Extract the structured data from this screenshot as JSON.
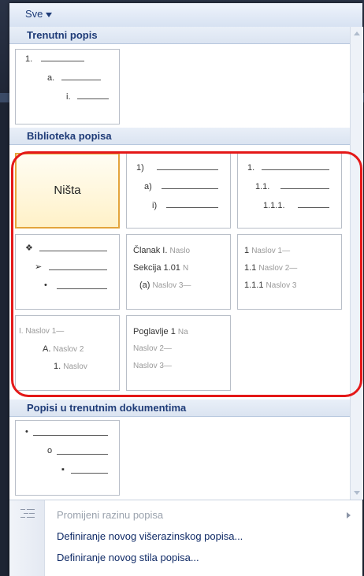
{
  "filter": {
    "label": "Sve"
  },
  "sections": {
    "current": "Trenutni popis",
    "library": "Biblioteka popisa",
    "documents": "Popisi u trenutnim dokumentima"
  },
  "current_tile": {
    "l1": "1.",
    "l2": "a.",
    "l3": "i."
  },
  "library_tiles": {
    "none": {
      "label": "Ništa"
    },
    "numbered": {
      "l1": "1)",
      "l2": "a)",
      "l3": "i)"
    },
    "decimal": {
      "l1": "1.",
      "l2": "1.1.",
      "l3": "1.1.1."
    },
    "bullets": {
      "l1": "❖",
      "l2": "➢",
      "l3": "•"
    },
    "article": {
      "l1": "Članak I.",
      "l1b": "Naslo",
      "l2": "Sekcija 1.01",
      "l2b": "N",
      "l3": "(a)",
      "l3b": "Naslov 3—"
    },
    "heading_num": {
      "l1": "1",
      "l1b": "Naslov 1—",
      "l2": "1.1",
      "l2b": "Naslov 2—",
      "l3": "1.1.1",
      "l3b": "Naslov 3"
    },
    "roman": {
      "l1": "I.",
      "l1b": "Naslov 1—",
      "l2": "A.",
      "l2b": "Naslov 2",
      "l3": "1.",
      "l3b": "Naslov"
    },
    "chapter": {
      "l1": "Poglavlje 1",
      "l1b": "Na",
      "l2": "Naslov 2—",
      "l3": "Naslov 3—"
    }
  },
  "doc_tile": {
    "l1": "•",
    "l2": "o",
    "l3": "▪"
  },
  "menu": {
    "change_level": "Promijeni razinu popisa",
    "define_multilevel": "Definiranje novog višerazinskog popisa...",
    "define_style": "Definiranje novog stila popisa..."
  },
  "colors": {
    "accent": "#1f3c78",
    "highlight": "#e41818",
    "selected": "#e3a43c"
  },
  "icons": {
    "change_level": "indent-list-icon",
    "submenu": "submenu-arrow-icon"
  }
}
